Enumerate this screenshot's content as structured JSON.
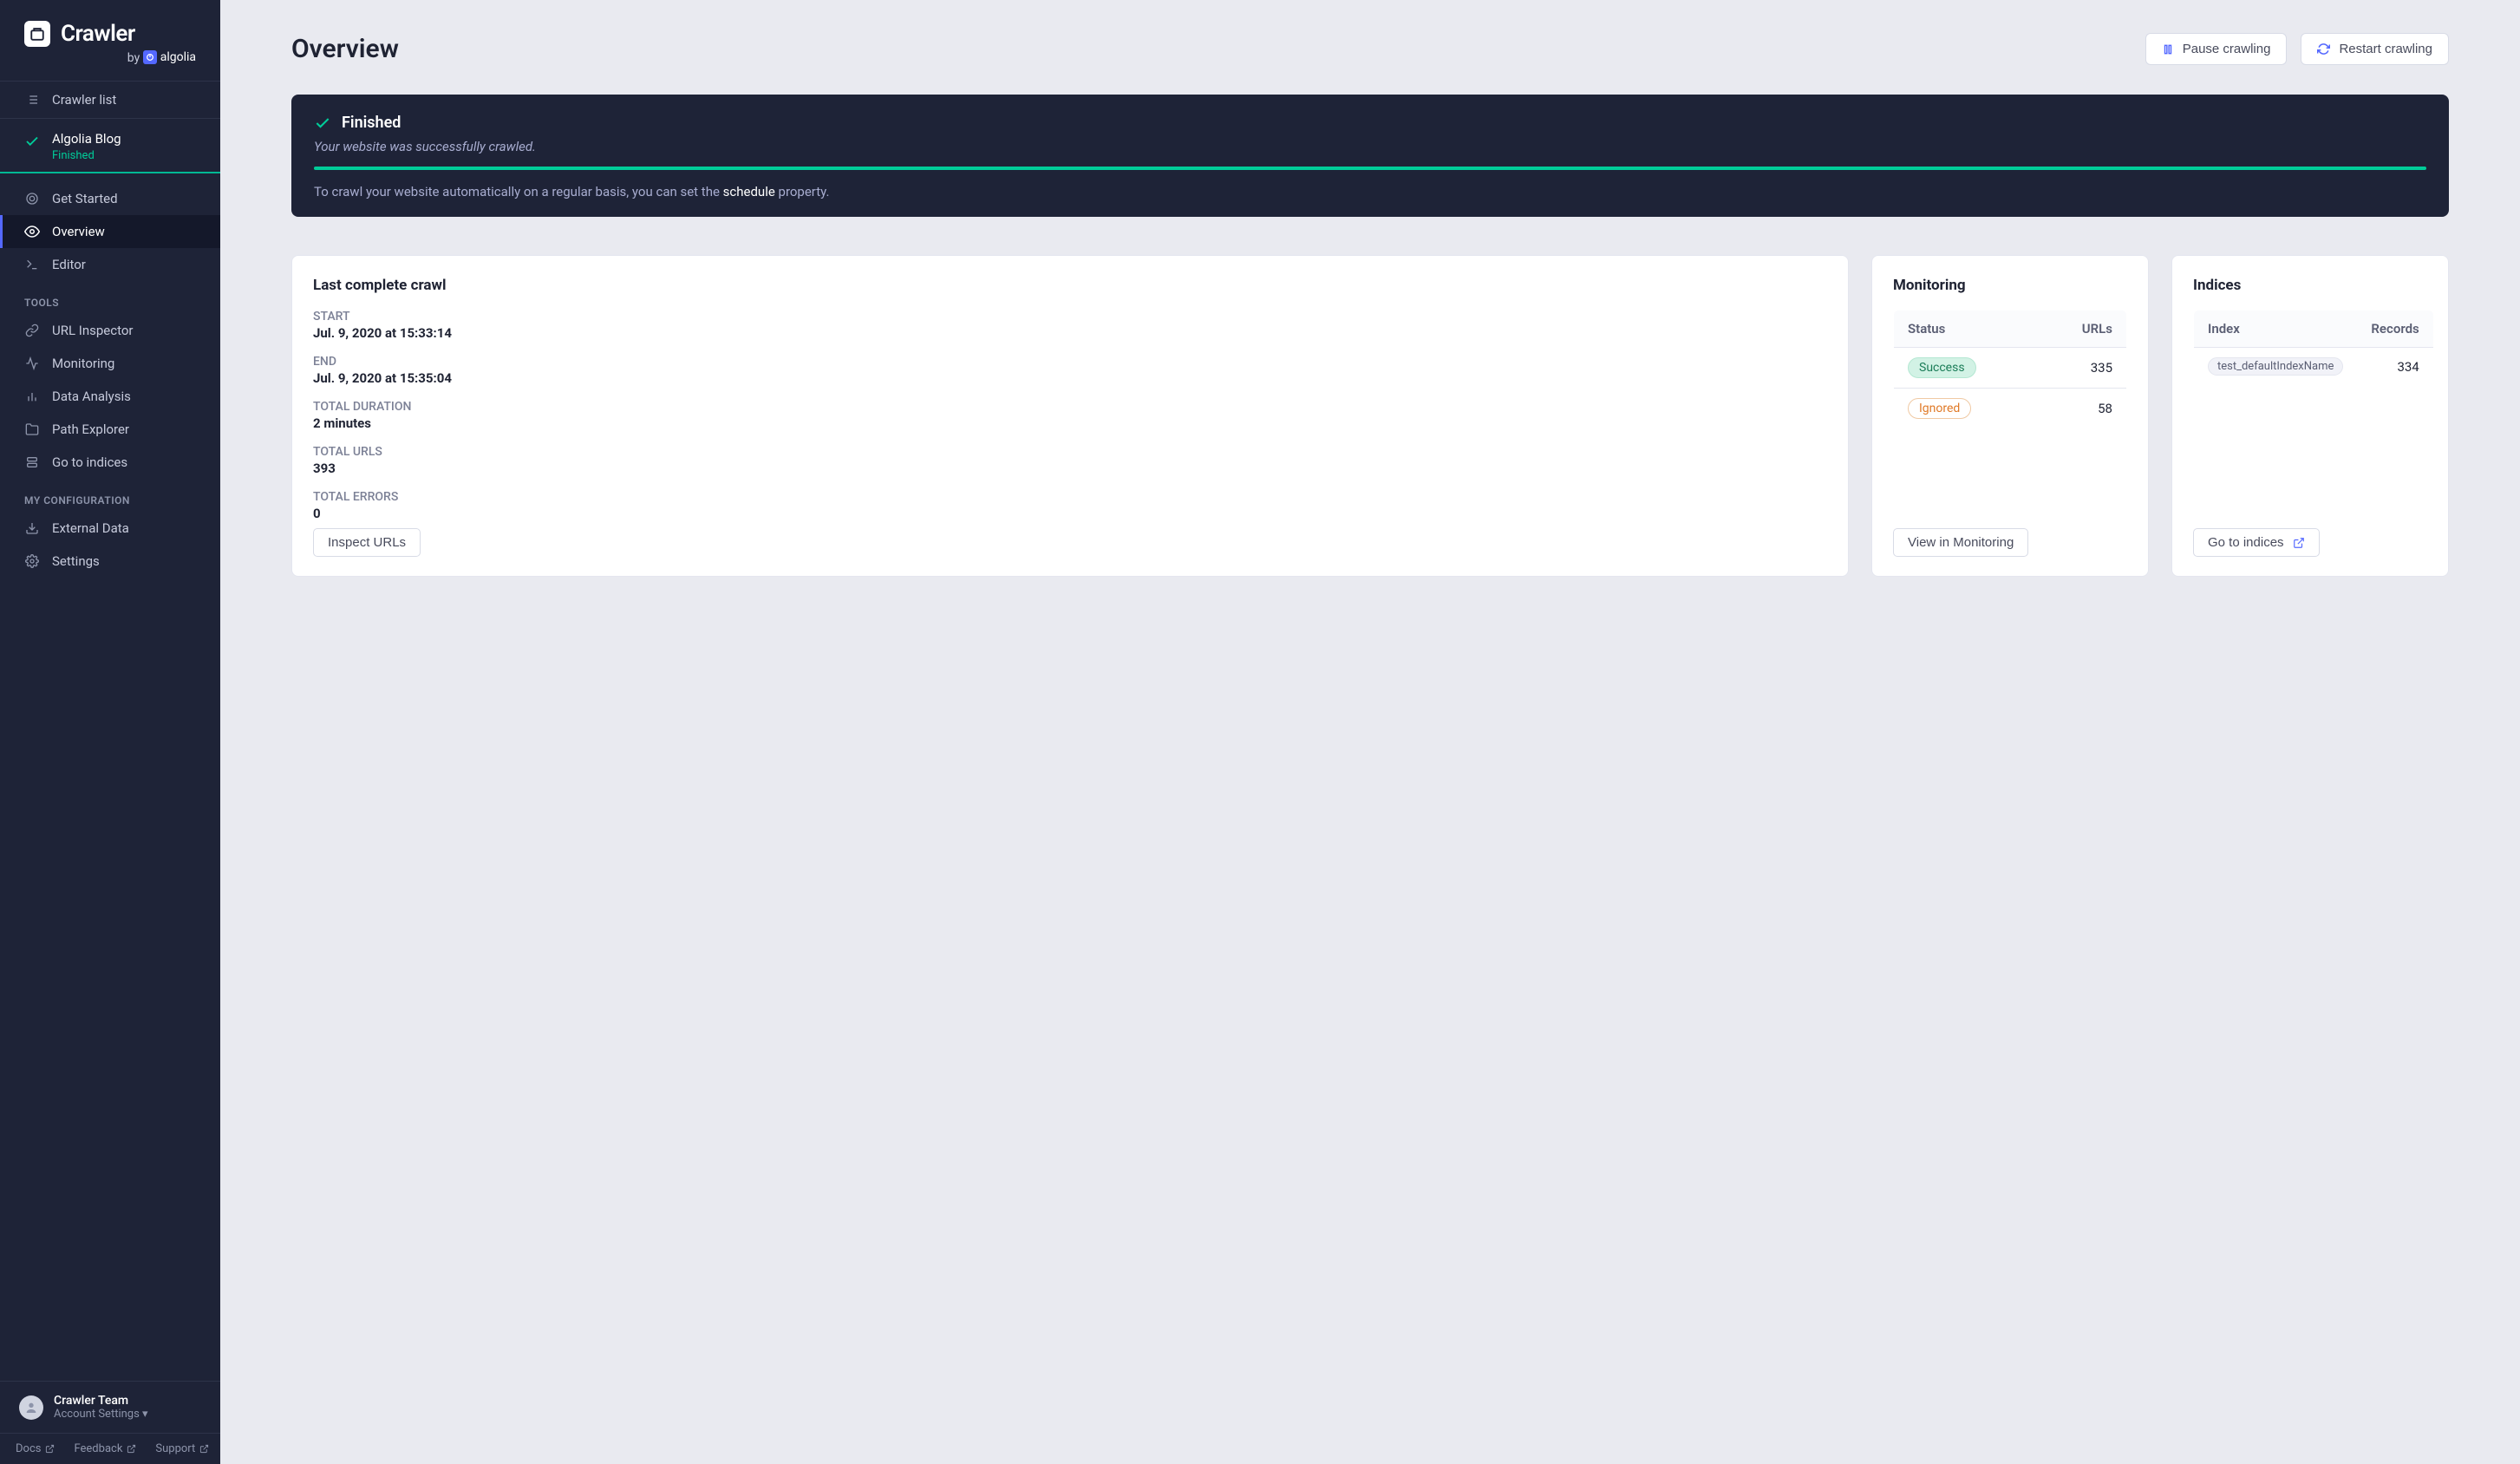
{
  "brand": {
    "name": "Crawler",
    "by_prefix": "by",
    "provider": "algolia"
  },
  "sidebar": {
    "crawler_list": "Crawler list",
    "project": {
      "name": "Algolia Blog",
      "status": "Finished"
    },
    "nav": {
      "get_started": "Get Started",
      "overview": "Overview",
      "editor": "Editor"
    },
    "sections": {
      "tools": "TOOLS",
      "my_config": "MY CONFIGURATION"
    },
    "tools": {
      "url_inspector": "URL Inspector",
      "monitoring": "Monitoring",
      "data_analysis": "Data Analysis",
      "path_explorer": "Path Explorer",
      "go_to_indices": "Go to indices"
    },
    "config": {
      "external_data": "External Data",
      "settings": "Settings"
    },
    "account": {
      "team": "Crawler Team",
      "settings": "Account Settings"
    },
    "footer": {
      "docs": "Docs",
      "feedback": "Feedback",
      "support": "Support"
    }
  },
  "header": {
    "title": "Overview",
    "pause_btn": "Pause crawling",
    "restart_btn": "Restart crawling"
  },
  "banner": {
    "title": "Finished",
    "message": "Your website was successfully crawled.",
    "hint_prefix": "To crawl your website automatically on a regular basis, you can set the ",
    "hint_link": "schedule",
    "hint_suffix": " property.",
    "progress_pct": "100"
  },
  "crawl_card": {
    "title": "Last complete crawl",
    "stats": {
      "start_label": "START",
      "start_value": "Jul. 9, 2020 at 15:33:14",
      "end_label": "END",
      "end_value": "Jul. 9, 2020 at 15:35:04",
      "duration_label": "TOTAL DURATION",
      "duration_value": "2 minutes",
      "urls_label": "TOTAL URLS",
      "urls_value": "393",
      "errors_label": "TOTAL ERRORS",
      "errors_value": "0"
    },
    "button": "Inspect URLs"
  },
  "monitoring_card": {
    "title": "Monitoring",
    "headers": {
      "status": "Status",
      "urls": "URLs"
    },
    "rows": [
      {
        "label": "Success",
        "class": "success",
        "count": "335"
      },
      {
        "label": "Ignored",
        "class": "ignored",
        "count": "58"
      }
    ],
    "button": "View in Monitoring"
  },
  "indices_card": {
    "title": "Indices",
    "headers": {
      "index": "Index",
      "records": "Records"
    },
    "rows": [
      {
        "name": "test_defaultIndexName",
        "records": "334"
      }
    ],
    "button": "Go to indices"
  }
}
